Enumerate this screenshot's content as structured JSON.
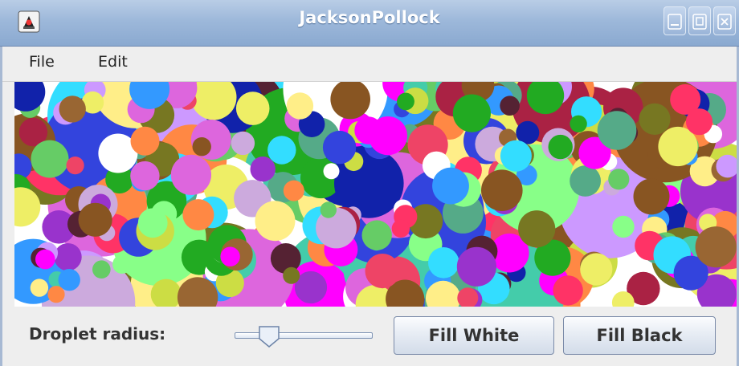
{
  "window": {
    "title": "JacksonPollock",
    "accent": "#9db8da"
  },
  "menu": {
    "items": [
      {
        "label": "File"
      },
      {
        "label": "Edit"
      }
    ]
  },
  "controls": {
    "droplet_label": "Droplet radius:",
    "slider_value": 0.2,
    "fill_white_label": "Fill White",
    "fill_black_label": "Fill Black"
  },
  "icons": {
    "app": "java-duke-icon",
    "minimize": "minimize-icon",
    "maximize": "maximize-icon",
    "close": "close-icon"
  },
  "palette": [
    "#ff00ff",
    "#22aa22",
    "#3344dd",
    "#ee4466",
    "#66cc66",
    "#ccdd44",
    "#aa2244",
    "#ffee88",
    "#44ccaa",
    "#885522",
    "#33ddff",
    "#9933cc",
    "#ff8844",
    "#ffffff",
    "#552233",
    "#ccaadd",
    "#1122aa",
    "#88ff88",
    "#dd66dd",
    "#996633",
    "#55aa88",
    "#eeee66",
    "#3399ff",
    "#ff3366",
    "#777722",
    "#cc99ff"
  ]
}
